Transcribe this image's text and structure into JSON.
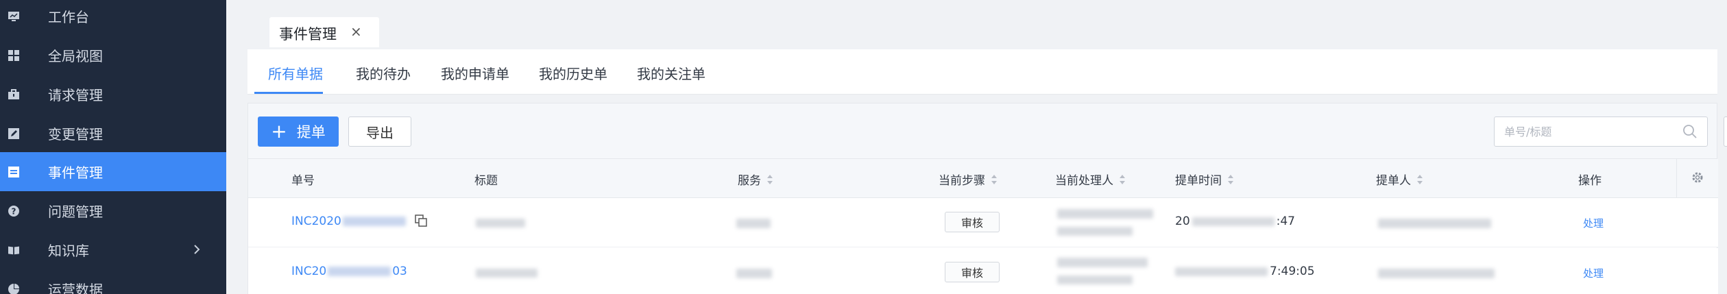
{
  "sidebar": {
    "items": [
      {
        "label": "工作台",
        "icon": "monitor-icon",
        "active": false
      },
      {
        "label": "全局视图",
        "icon": "grid-icon",
        "active": false
      },
      {
        "label": "请求管理",
        "icon": "briefcase-icon",
        "active": false
      },
      {
        "label": "变更管理",
        "icon": "edit-icon",
        "active": false
      },
      {
        "label": "事件管理",
        "icon": "event-icon",
        "active": true
      },
      {
        "label": "问题管理",
        "icon": "question-icon",
        "active": false
      },
      {
        "label": "知识库",
        "icon": "book-icon",
        "active": false,
        "has_submenu": true
      },
      {
        "label": "运营数据",
        "icon": "pie-chart-icon",
        "active": false
      }
    ]
  },
  "page_tab": {
    "label": "事件管理",
    "close": "×"
  },
  "subtabs": [
    {
      "label": "所有单据",
      "active": true
    },
    {
      "label": "我的待办",
      "active": false
    },
    {
      "label": "我的申请单",
      "active": false
    },
    {
      "label": "我的历史单",
      "active": false
    },
    {
      "label": "我的关注单",
      "active": false
    }
  ],
  "toolbar": {
    "create_label": "提单",
    "export_label": "导出",
    "search_placeholder": "单号/标题"
  },
  "table": {
    "columns": [
      "单号",
      "标题",
      "服务",
      "当前步骤",
      "当前处理人",
      "提单时间",
      "提单人",
      "操作"
    ],
    "rows": [
      {
        "id": "INC2020",
        "status": "审核",
        "time_prefix": "20",
        "time_suffix": ":47",
        "action": "处理"
      },
      {
        "id_prefix": "INC20",
        "id_suffix": "03",
        "status": "审核",
        "time_suffix": "7:49:05",
        "action": "处理"
      }
    ]
  },
  "colors": {
    "accent": "#3d88f5",
    "sidebar_bg": "#1f2a3d"
  }
}
